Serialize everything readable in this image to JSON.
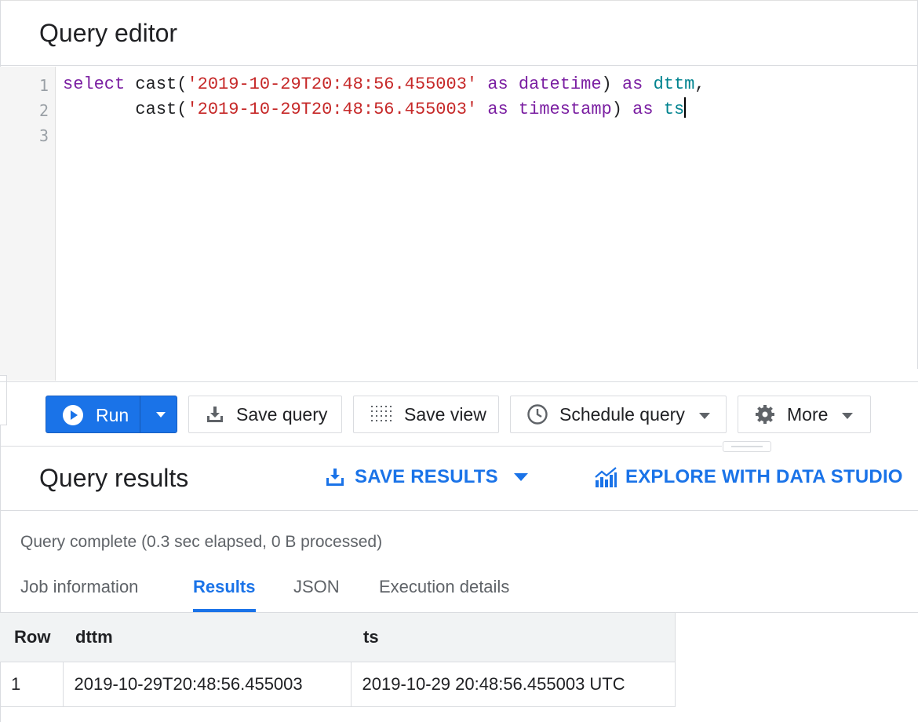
{
  "editor": {
    "title": "Query editor",
    "line_numbers": [
      "1",
      "2",
      "3"
    ],
    "lines": [
      [
        {
          "t": "select",
          "c": "kw"
        },
        {
          "t": " cast(",
          "c": "plain"
        },
        {
          "t": "'2019-10-29T20:48:56.455003'",
          "c": "str"
        },
        {
          "t": " ",
          "c": "plain"
        },
        {
          "t": "as",
          "c": "kw"
        },
        {
          "t": " ",
          "c": "plain"
        },
        {
          "t": "datetime",
          "c": "kw"
        },
        {
          "t": ") ",
          "c": "plain"
        },
        {
          "t": "as",
          "c": "kw"
        },
        {
          "t": " ",
          "c": "plain"
        },
        {
          "t": "dttm",
          "c": "id"
        },
        {
          "t": ",",
          "c": "plain"
        }
      ],
      [
        {
          "t": "       cast(",
          "c": "plain"
        },
        {
          "t": "'2019-10-29T20:48:56.455003'",
          "c": "str"
        },
        {
          "t": " ",
          "c": "plain"
        },
        {
          "t": "as",
          "c": "kw"
        },
        {
          "t": " ",
          "c": "plain"
        },
        {
          "t": "timestamp",
          "c": "kw"
        },
        {
          "t": ") ",
          "c": "plain"
        },
        {
          "t": "as",
          "c": "kw"
        },
        {
          "t": " ",
          "c": "plain"
        },
        {
          "t": "ts",
          "c": "id"
        }
      ],
      []
    ]
  },
  "toolbar": {
    "run_label": "Run",
    "save_query_label": "Save query",
    "save_view_label": "Save view",
    "schedule_label": "Schedule query",
    "more_label": "More"
  },
  "results": {
    "title": "Query results",
    "save_results_label": "SAVE RESULTS",
    "explore_label": "EXPLORE WITH DATA STUDIO",
    "status": "Query complete (0.3 sec elapsed, 0 B processed)",
    "tabs": [
      "Job information",
      "Results",
      "JSON",
      "Execution details"
    ],
    "active_tab": "Results",
    "columns": [
      "Row",
      "dttm",
      "ts"
    ],
    "rows": [
      [
        "1",
        "2019-10-29T20:48:56.455003",
        "2019-10-29 20:48:56.455003 UTC"
      ]
    ]
  },
  "colors": {
    "accent": "#1a73e8",
    "keyword": "#7b1fa2",
    "string": "#c62828",
    "identifier": "#00838f"
  },
  "icons": {
    "run": "play-circle-icon",
    "run_menu": "caret-down-icon",
    "save_query": "download-tray-icon",
    "save_view": "dotted-grid-icon",
    "schedule": "clock-icon",
    "more": "gear-icon",
    "save_results": "download-tray-icon",
    "explore": "bar-chart-icon"
  }
}
